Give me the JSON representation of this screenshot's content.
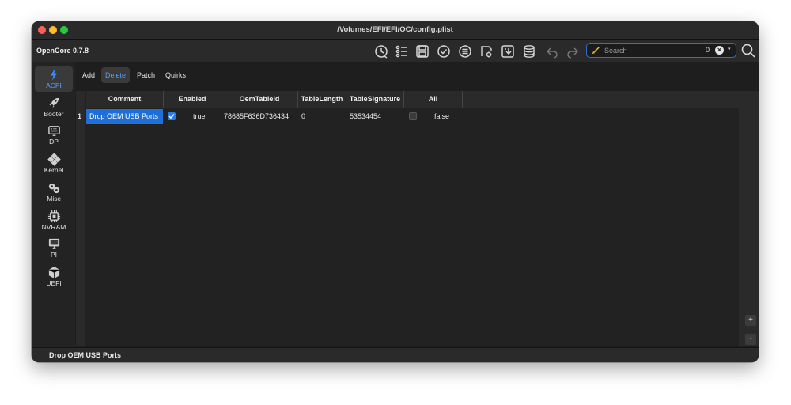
{
  "window": {
    "title": "/Volumes/EFI/EFI/OC/config.plist"
  },
  "toolbar": {
    "app_name": "OpenCore 0.7.8",
    "icons": [
      "clock-icon",
      "list-icon",
      "save-icon",
      "check-circle-icon",
      "list-circle-icon",
      "gear-page-icon",
      "import-icon",
      "database-icon",
      "undo-icon",
      "redo-icon"
    ]
  },
  "search": {
    "placeholder": "Search",
    "count": "0",
    "clear_glyph": "×",
    "dropdown_glyph": "▾"
  },
  "sidebar": {
    "items": [
      {
        "label": "ACPI",
        "icon": "lightning-icon",
        "active": true
      },
      {
        "label": "Booter",
        "icon": "rocket-icon"
      },
      {
        "label": "DP",
        "icon": "keyboard-icon"
      },
      {
        "label": "Kernel",
        "icon": "puzzle-icon"
      },
      {
        "label": "Misc",
        "icon": "gears-icon"
      },
      {
        "label": "NVRAM",
        "icon": "chip-icon"
      },
      {
        "label": "PI",
        "icon": "monitor-icon"
      },
      {
        "label": "UEFI",
        "icon": "cube-icon"
      }
    ]
  },
  "tabs": [
    {
      "label": "Add"
    },
    {
      "label": "Delete",
      "active": true
    },
    {
      "label": "Patch"
    },
    {
      "label": "Quirks"
    }
  ],
  "table": {
    "columns": [
      "Comment",
      "Enabled",
      "OemTableId",
      "TableLength",
      "TableSignature",
      "All"
    ],
    "rows": [
      {
        "num": "1",
        "comment": "Drop OEM USB Ports",
        "enabled_checked": true,
        "enabled": "true",
        "oemtableid": "78685F636D736434",
        "tablelength": "0",
        "tablesignature": "53534454",
        "all_checked": false,
        "all": "false"
      }
    ]
  },
  "side_buttons": {
    "add": "+",
    "remove": "-"
  },
  "status": {
    "text": "Drop OEM USB Ports"
  },
  "colors": {
    "accent": "#1f6fd8",
    "active_text": "#4ea0ff",
    "background": "#1e1e1e"
  }
}
